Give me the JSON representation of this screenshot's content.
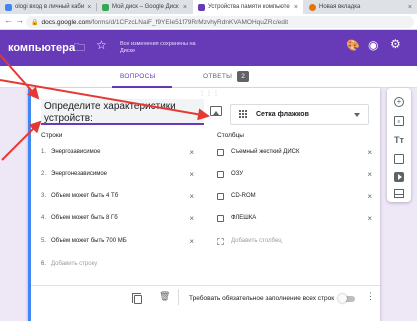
{
  "browser": {
    "tabs": [
      {
        "label": "ologi вход в личный каби",
        "favicon_color": "#4285f4",
        "active": false
      },
      {
        "label": "Мой диск – Google Диск",
        "favicon_color": "#34a853",
        "active": false
      },
      {
        "label": "Устройства памяти компьюте",
        "favicon_color": "#673ab7",
        "active": true
      },
      {
        "label": "Новая вкладка",
        "favicon_color": "#e8710a",
        "active": false
      }
    ],
    "close_glyph": "×",
    "url_domain": "docs.google.com",
    "url_rest": "/forms/d/1CFzcLNaiF_f9YEIe51f79RrMzvhyRdnKVAMOHquZRc/edit",
    "back_icon": "back-arrow-icon",
    "forward_icon": "forward-arrow-icon"
  },
  "form_header": {
    "title": "компьютера",
    "saved_status": "Все изменения сохранены на Диске",
    "accent_color": "#673ab7"
  },
  "form_tabs": {
    "questions": "ВОПРОСЫ",
    "answers": "ОТВЕТЫ",
    "answers_count": "2"
  },
  "question": {
    "title": "Определите характеристики устройств:",
    "type_label": "Сетка флажков",
    "rows_header": "Строки",
    "columns_header": "Столбцы",
    "rows": [
      {
        "num": "1.",
        "label": "Энергозависимое"
      },
      {
        "num": "2.",
        "label": "Энергонезависимое"
      },
      {
        "num": "3.",
        "label": "Объем может быть 4 Тб"
      },
      {
        "num": "4.",
        "label": "Объем может быть 8 Гб"
      },
      {
        "num": "5.",
        "label": "Объем может быть 700 МБ"
      }
    ],
    "add_row_num": "6.",
    "add_row": "Добавить строку",
    "columns": [
      {
        "label": "Съемный жесткий ДИСК"
      },
      {
        "label": "ОЗУ"
      },
      {
        "label": "CD-ROM"
      },
      {
        "label": "ФЛЕШКА"
      }
    ],
    "add_column": "Добавить столбец",
    "remove_glyph": "×",
    "required_label": "Требовать обязательное заполнение всех строк",
    "required_on": false
  },
  "sidebar_icons": [
    "add-question-icon",
    "import-questions-icon",
    "title-text-icon",
    "image-icon",
    "video-icon",
    "section-icon"
  ],
  "annotation_color": "#e53935"
}
